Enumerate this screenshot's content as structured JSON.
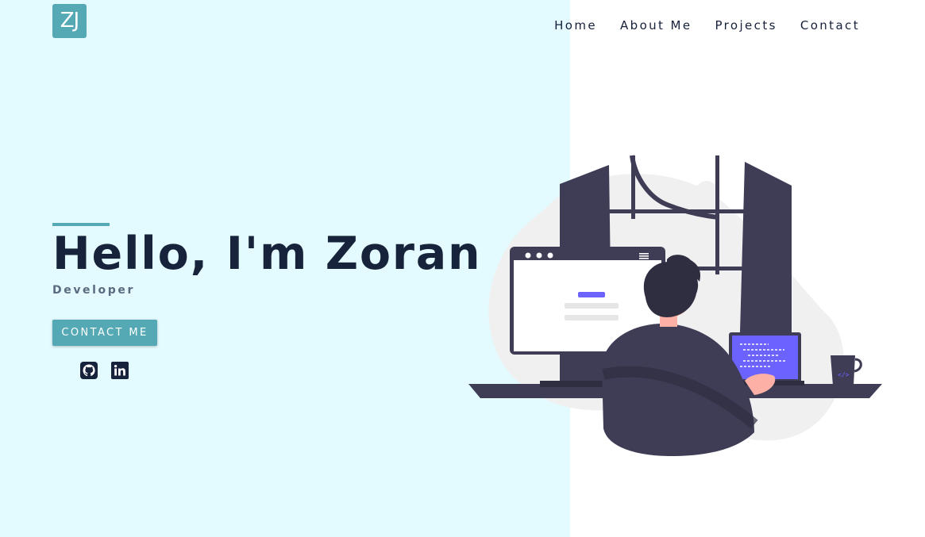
{
  "header": {
    "logo_text": "ZJ",
    "nav": [
      "Home",
      "About Me",
      "Projects",
      "Contact"
    ]
  },
  "hero": {
    "title": "Hello, I'm Zoran",
    "subtitle": "Developer",
    "cta_label": "CONTACT ME"
  },
  "social": {
    "github_icon": "github-icon",
    "linkedin_icon": "linkedin-icon"
  },
  "colors": {
    "accent": "#54a9b5",
    "left_background": "#e3fbfe",
    "heading": "#16233b",
    "illustration_dark": "#3f3d56",
    "illustration_purple": "#6c63ff"
  }
}
